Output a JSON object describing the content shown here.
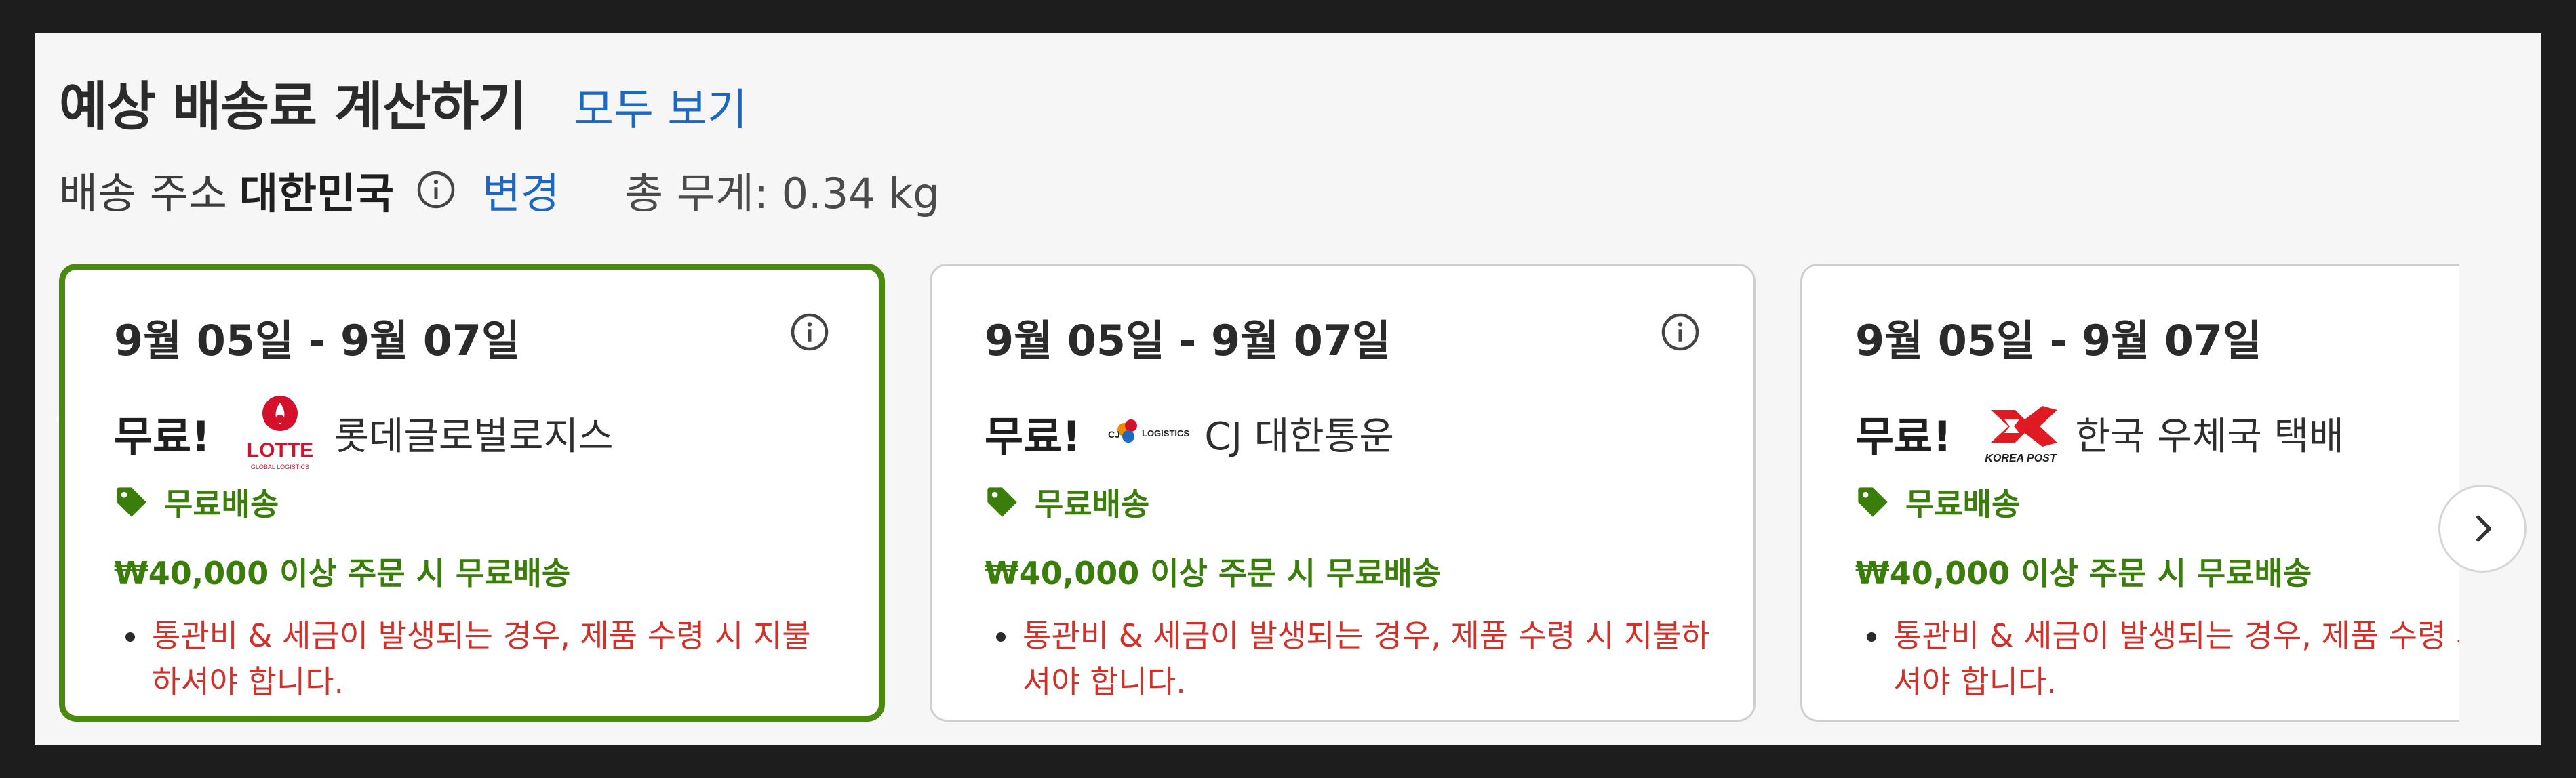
{
  "header": {
    "title": "예상 배송료 계산하기",
    "view_all": "모두 보기"
  },
  "address": {
    "label": "배송 주소",
    "country": "대한민국",
    "change": "변경",
    "weight": "총 무게: 0.34 kg"
  },
  "options": [
    {
      "dates": "9월 05일 - 9월 07일",
      "price": "무료!",
      "carrier": "롯데글로벌로지스",
      "logo_text": "LOTTE",
      "logo_sub": "GLOBAL LOGISTICS",
      "shipping_label": "무료배송",
      "threshold": "₩40,000 이상 주문 시 무료배송",
      "note": "통관비 & 세금이 발생되는 경우, 제품 수령 시 지불하셔야 합니다.",
      "selected": true
    },
    {
      "dates": "9월 05일 - 9월 07일",
      "price": "무료!",
      "carrier": "CJ 대한통운",
      "logo_text": "CJ",
      "logo_sub": "LOGISTICS",
      "shipping_label": "무료배송",
      "threshold": "₩40,000 이상 주문 시 무료배송",
      "note": "통관비 & 세금이 발생되는 경우, 제품 수령 시 지불하셔야 합니다.",
      "selected": false
    },
    {
      "dates": "9월 05일 - 9월 07일",
      "price": "무료!",
      "carrier": "한국 우체국 택배",
      "logo_text": "KOREA POST",
      "shipping_label": "무료배송",
      "threshold": "₩40,000 이상 주문 시 무료배송",
      "note": "통관비 & 세금이 발생되는 경우, 제품 수령 시 지불하셔야 합니다.",
      "selected": false
    }
  ],
  "icons": {
    "info": "info-icon",
    "tag": "price-tag-icon",
    "next": "chevron-right-icon"
  },
  "colors": {
    "accent_link": "#1a67c4",
    "selected_border": "#4a8a10",
    "free_green": "#3a7d0a",
    "note_red": "#d3302a",
    "lotte_red": "#d4102a",
    "kpost_red": "#e01a22"
  }
}
